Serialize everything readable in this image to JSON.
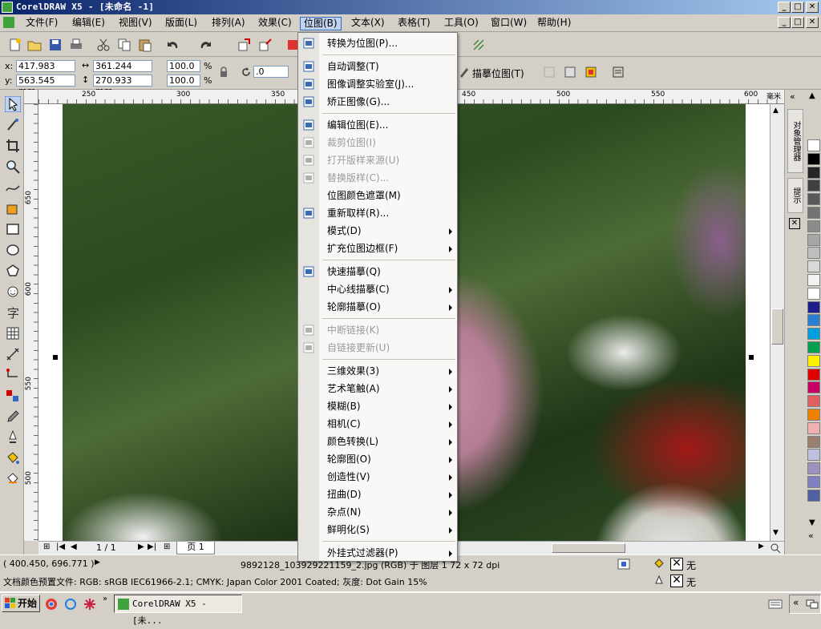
{
  "window": {
    "title": "CorelDRAW X5 - [未命名 -1]",
    "min": "_",
    "max": "□",
    "close": "✕"
  },
  "menubar": [
    {
      "label": "文件(F)"
    },
    {
      "label": "编辑(E)"
    },
    {
      "label": "视图(V)"
    },
    {
      "label": "版面(L)"
    },
    {
      "label": "排列(A)"
    },
    {
      "label": "效果(C)"
    },
    {
      "label": "位图(B)"
    },
    {
      "label": "文本(X)"
    },
    {
      "label": "表格(T)"
    },
    {
      "label": "工具(O)"
    },
    {
      "label": "窗口(W)"
    },
    {
      "label": "帮助(H)"
    }
  ],
  "propbar": {
    "x_label": "x:",
    "x_value": "417.983 mm",
    "y_label": "y:",
    "y_value": "563.545 mm",
    "w_value": "361.244 mm",
    "h_value": "270.933 mm",
    "scale_x": "100.0",
    "scale_y": "100.0",
    "pct": "%",
    "rotation": ".0",
    "trace_label": "描摹位图(T)"
  },
  "ruler": {
    "h_ticks": [
      "250",
      "300",
      "350",
      "450",
      "500",
      "550",
      "600"
    ],
    "unit": "毫米",
    "v_ticks": [
      "650",
      "600",
      "550",
      "500"
    ]
  },
  "bitmap_menu": {
    "items": [
      {
        "label": "转换为位图(P)...",
        "enabled": true,
        "submenu": false
      },
      {
        "label": "自动调整(T)",
        "enabled": true,
        "submenu": false
      },
      {
        "label": "图像调整实验室(J)...",
        "enabled": true,
        "submenu": false
      },
      {
        "label": "矫正图像(G)...",
        "enabled": true,
        "submenu": false
      },
      {
        "label": "编辑位图(E)...",
        "enabled": true,
        "submenu": false
      },
      {
        "label": "裁剪位图(I)",
        "enabled": false,
        "submenu": false
      },
      {
        "label": "打开版样来源(U)",
        "enabled": false,
        "submenu": false
      },
      {
        "label": "替换版样(C)...",
        "enabled": false,
        "submenu": false
      },
      {
        "label": "位图颜色遮罩(M)",
        "enabled": true,
        "submenu": false
      },
      {
        "label": "重新取样(R)...",
        "enabled": true,
        "submenu": false
      },
      {
        "label": "模式(D)",
        "enabled": true,
        "submenu": true
      },
      {
        "label": "扩充位图边框(F)",
        "enabled": true,
        "submenu": true
      },
      {
        "label": "快速描摹(Q)",
        "enabled": true,
        "submenu": false
      },
      {
        "label": "中心线描摹(C)",
        "enabled": true,
        "submenu": true
      },
      {
        "label": "轮廓描摹(O)",
        "enabled": true,
        "submenu": true
      },
      {
        "label": "中断链接(K)",
        "enabled": false,
        "submenu": false
      },
      {
        "label": "自链接更新(U)",
        "enabled": false,
        "submenu": false
      },
      {
        "label": "三维效果(3)",
        "enabled": true,
        "submenu": true
      },
      {
        "label": "艺术笔触(A)",
        "enabled": true,
        "submenu": true
      },
      {
        "label": "模糊(B)",
        "enabled": true,
        "submenu": true
      },
      {
        "label": "相机(C)",
        "enabled": true,
        "submenu": true
      },
      {
        "label": "颜色转换(L)",
        "enabled": true,
        "submenu": true
      },
      {
        "label": "轮廓图(O)",
        "enabled": true,
        "submenu": true
      },
      {
        "label": "创造性(V)",
        "enabled": true,
        "submenu": true
      },
      {
        "label": "扭曲(D)",
        "enabled": true,
        "submenu": true
      },
      {
        "label": "杂点(N)",
        "enabled": true,
        "submenu": true
      },
      {
        "label": "鲜明化(S)",
        "enabled": true,
        "submenu": true
      },
      {
        "label": "外挂式过滤器(P)",
        "enabled": true,
        "submenu": true
      }
    ]
  },
  "page_nav": {
    "counter": "1 / 1",
    "tab": "页 1"
  },
  "dock": {
    "tab1": "对象管理器",
    "tab2": "提示"
  },
  "palette_colors": [
    "#ffffff",
    "#000000",
    "#262626",
    "#404040",
    "#595959",
    "#737373",
    "#8c8c8c",
    "#a6a6a6",
    "#bfbfbf",
    "#d9d9d9",
    "#f2f2f2",
    "#ffffff",
    "#1d1d8c",
    "#2a7fd4",
    "#00a0e0",
    "#00a050",
    "#ffee00",
    "#e00000",
    "#c80064",
    "#e06060",
    "#f08000",
    "#f0b0b0",
    "#9a8070",
    "#c0c0e0",
    "#a090c0",
    "#8080c0",
    "#5060a0"
  ],
  "status": {
    "coords": "( 400.450, 696.771 )",
    "doc_info": "9892128_103929221159_2.jpg (RGB) 于 图层 1 72 x 72 dpi",
    "fill_label": "无",
    "outline_label": "无",
    "color_profile": "文档颜色预置文件: RGB: sRGB IEC61966-2.1; CMYK: Japan Color 2001 Coated; 灰度: Dot Gain 15%"
  },
  "taskbar": {
    "start": "开始",
    "task": "CorelDRAW X5 - [未..."
  }
}
